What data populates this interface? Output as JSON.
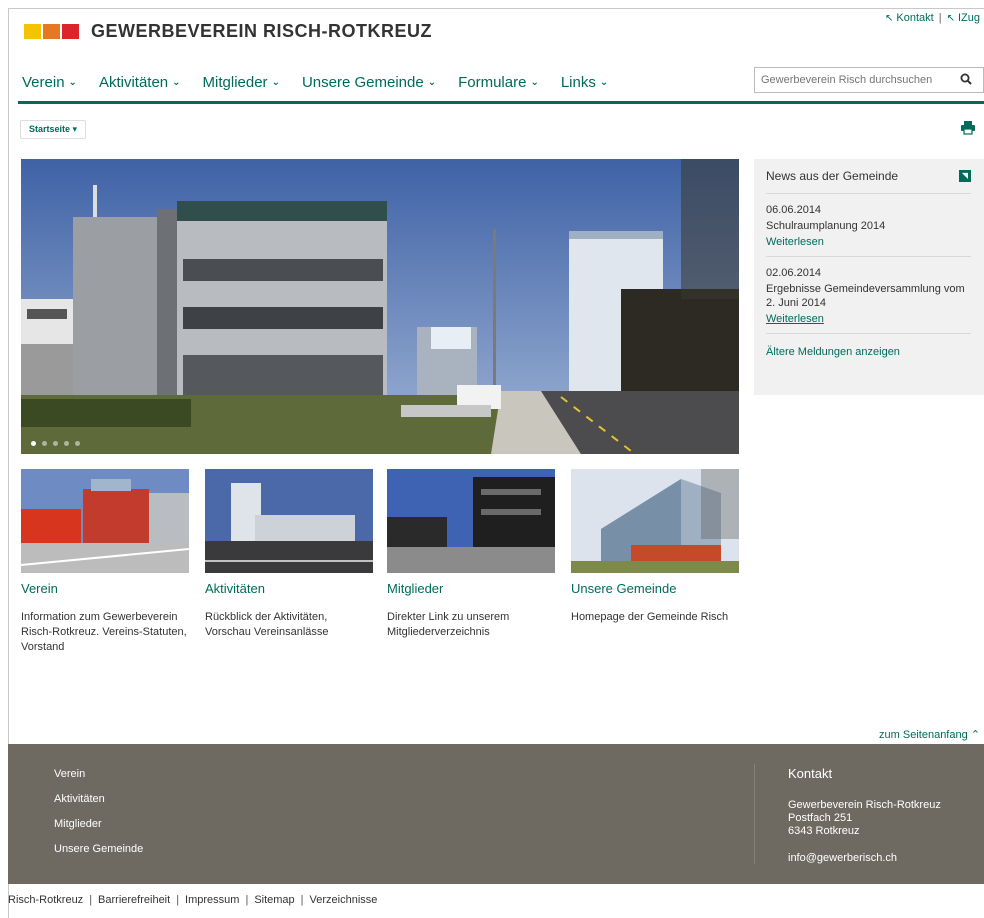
{
  "colors": {
    "accent": "#006b5a",
    "footer_bg": "#6e6a62",
    "logo_yellow": "#f5c400",
    "logo_orange": "#e87722",
    "logo_red": "#d9252b"
  },
  "header": {
    "site_title": "GEWERBEVEREIN RISCH-ROTKREUZ",
    "service_links": [
      "Kontakt",
      "IZug"
    ],
    "search_placeholder": "Gewerbeverein Risch durchsuchen"
  },
  "nav": [
    {
      "label": "Verein"
    },
    {
      "label": "Aktivitäten"
    },
    {
      "label": "Mitglieder"
    },
    {
      "label": "Unsere Gemeinde"
    },
    {
      "label": "Formulare"
    },
    {
      "label": "Links"
    }
  ],
  "breadcrumb": {
    "label": "Startseite"
  },
  "news": {
    "heading": "News aus der Gemeinde",
    "items": [
      {
        "date": "06.06.2014",
        "title": "Schulraumplanung 2014",
        "more": "Weiterlesen"
      },
      {
        "date": "02.06.2014",
        "title": "Ergebnisse Gemeindeversammlung vom 2. Juni 2014",
        "more": "Weiterlesen"
      }
    ],
    "older": "Ältere Meldungen anzeigen"
  },
  "teasers": [
    {
      "title": "Verein",
      "desc": "Information zum Gewerbeverein Risch-Rotkreuz. Vereins-Statuten, Vorstand"
    },
    {
      "title": "Aktivitäten",
      "desc": "Rückblick der Aktivitäten, Vorschau Vereinsanlässe"
    },
    {
      "title": "Mitglieder",
      "desc": "Direkter Link zu unserem Mitgliederverzeichnis"
    },
    {
      "title": "Unsere Gemeinde",
      "desc": "Homepage der Gemeinde Risch"
    }
  ],
  "to_top": "zum Seitenanfang",
  "footer": {
    "links": [
      "Verein",
      "Aktivitäten",
      "Mitglieder",
      "Unsere Gemeinde"
    ],
    "contact_title": "Kontakt",
    "contact_lines": [
      "Gewerbeverein Risch-Rotkreuz",
      "Postfach 251",
      "6343 Rotkreuz"
    ],
    "email": "info@gewerberisch.ch"
  },
  "legal": [
    "Risch-Rotkreuz",
    "Barrierefreiheit",
    "Impressum",
    "Sitemap",
    "Verzeichnisse"
  ]
}
